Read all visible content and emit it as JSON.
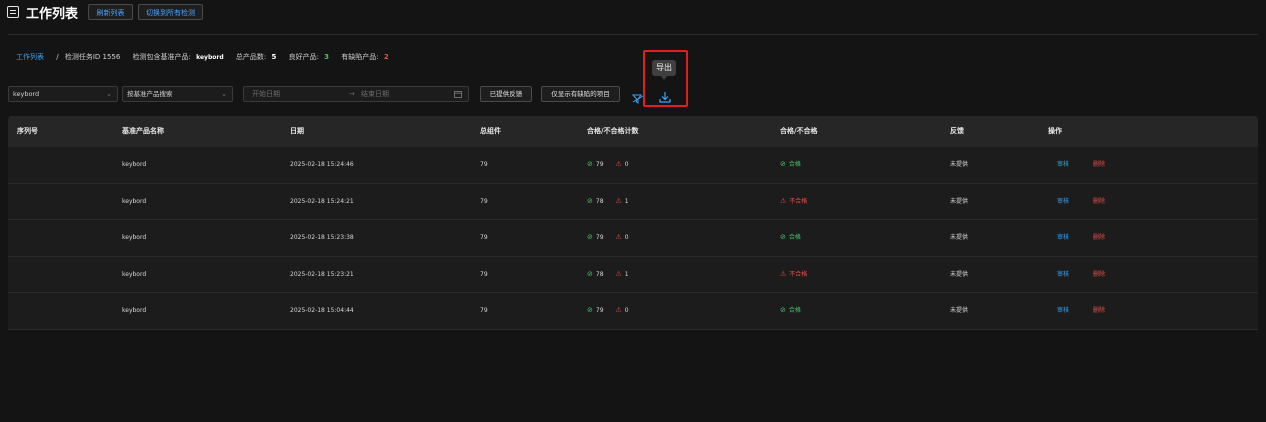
{
  "header": {
    "title": "工作列表",
    "refresh_label": "刷新列表",
    "switch_label": "切换到所有检测"
  },
  "summary": {
    "link": "工作列表",
    "sep": "/",
    "task_label": "检测任务ID 1556",
    "base_label": "检测包含基准产品:",
    "base_value": "keybord",
    "total_label": "总产品数:",
    "total_value": "5",
    "good_label": "良好产品:",
    "good_value": "3",
    "defect_label": "有缺陷产品:",
    "defect_value": "2"
  },
  "filters": {
    "product_select": "keybord",
    "base_search": "按基准产品搜索",
    "date_start": "开始日期",
    "date_arrow": "→",
    "date_end": "结束日期",
    "feedback_btn": "已提供反馈",
    "defect_only_btn": "仅显示有缺陷的项目",
    "export_tooltip": "导出"
  },
  "table": {
    "headers": [
      "序列号",
      "基准产品名称",
      "日期",
      "总组件",
      "合格/不合格计数",
      "合格/不合格",
      "反馈",
      "操作"
    ],
    "rows": [
      {
        "serial": "",
        "name": "keybord",
        "date": "2025-02-18 15:24:46",
        "total": "79",
        "pass": "79",
        "fail": "0",
        "status": "合格",
        "status_ok": true,
        "feedback": "未提供",
        "review": "审核",
        "delete": "删除"
      },
      {
        "serial": "",
        "name": "keybord",
        "date": "2025-02-18 15:24:21",
        "total": "79",
        "pass": "78",
        "fail": "1",
        "status": "不合格",
        "status_ok": false,
        "feedback": "未提供",
        "review": "审核",
        "delete": "删除"
      },
      {
        "serial": "",
        "name": "keybord",
        "date": "2025-02-18 15:23:38",
        "total": "79",
        "pass": "79",
        "fail": "0",
        "status": "合格",
        "status_ok": true,
        "feedback": "未提供",
        "review": "审核",
        "delete": "删除"
      },
      {
        "serial": "",
        "name": "keybord",
        "date": "2025-02-18 15:23:21",
        "total": "79",
        "pass": "78",
        "fail": "1",
        "status": "不合格",
        "status_ok": false,
        "feedback": "未提供",
        "review": "审核",
        "delete": "删除"
      },
      {
        "serial": "",
        "name": "keybord",
        "date": "2025-02-18 15:04:44",
        "total": "79",
        "pass": "79",
        "fail": "0",
        "status": "合格",
        "status_ok": true,
        "feedback": "未提供",
        "review": "审核",
        "delete": "删除"
      }
    ]
  },
  "colors": {
    "accent": "#3ba3f5",
    "ok": "#49c26a",
    "ng": "#e8504a",
    "highlight": "#e02020"
  },
  "icons": {
    "pass": "check-circle-icon",
    "fail": "warning-triangle-icon",
    "export": "download-icon",
    "clear_filter": "filter-clear-icon",
    "calendar": "calendar-icon"
  }
}
